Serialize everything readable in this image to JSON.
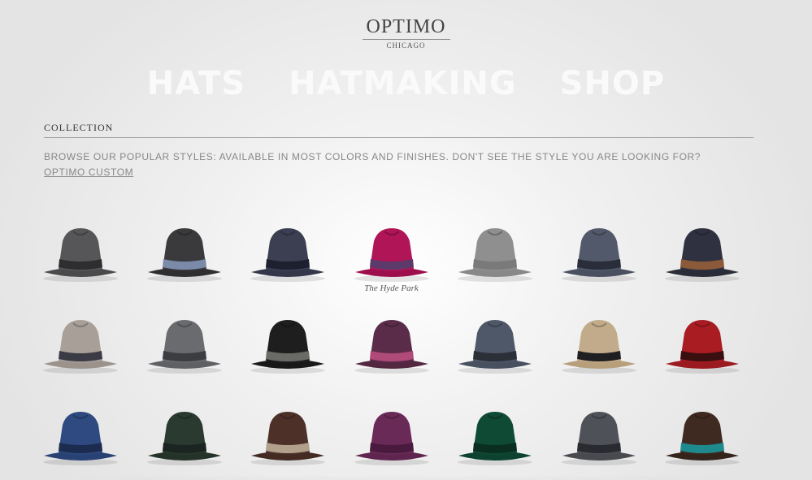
{
  "brand": {
    "name": "OPTIMO",
    "sub": "CHICAGO"
  },
  "nav": {
    "items": [
      "HATS",
      "HATMAKING",
      "SHOP"
    ]
  },
  "collection": {
    "title": "COLLECTION",
    "intro_text": "BROWSE OUR POPULAR STYLES: AVAILABLE IN MOST COLORS AND FINISHES. DON'T SEE THE STYLE YOU ARE LOOKING FOR? ",
    "intro_link": "OPTIMO CUSTOM"
  },
  "hats": [
    {
      "crown": "#565659",
      "band": "#2e2e30",
      "brim": "#4a4a4d"
    },
    {
      "crown": "#3a3a3d",
      "band": "#7a8aa8",
      "brim": "#2f2f32"
    },
    {
      "crown": "#3c3f52",
      "band": "#1e2030",
      "brim": "#34374a"
    },
    {
      "crown": "#b01558",
      "band": "#5c3a6a",
      "brim": "#9c0f4c",
      "label": "The Hyde Park"
    },
    {
      "crown": "#8f8f8f",
      "band": "#7a7a7a",
      "brim": "#888888"
    },
    {
      "crown": "#52596a",
      "band": "#2a2e3a",
      "brim": "#4a5060"
    },
    {
      "crown": "#2f3140",
      "band": "#8a5a3a",
      "brim": "#2a2c38"
    },
    {
      "crown": "#a89f98",
      "band": "#3a3b44",
      "brim": "#9a928b"
    },
    {
      "crown": "#6a6b6e",
      "band": "#3c3d40",
      "brim": "#5f6063"
    },
    {
      "crown": "#1e1e1e",
      "band": "#6a6a66",
      "brim": "#181818"
    },
    {
      "crown": "#5a2c4a",
      "band": "#b04a78",
      "brim": "#52273f"
    },
    {
      "crown": "#4f5868",
      "band": "#2a2f38",
      "brim": "#47505f"
    },
    {
      "crown": "#c2ab8a",
      "band": "#1f1f22",
      "brim": "#b89f7c"
    },
    {
      "crown": "#a81c22",
      "band": "#3a0f10",
      "brim": "#9a1a20"
    },
    {
      "crown": "#2f4a80",
      "band": "#1c2c4e",
      "brim": "#294274"
    },
    {
      "crown": "#2a3a30",
      "band": "#1a2420",
      "brim": "#243228"
    },
    {
      "crown": "#4d3128",
      "band": "#b0a08c",
      "brim": "#432a22"
    },
    {
      "crown": "#6a2a58",
      "band": "#4a1a3e",
      "brim": "#5f254f"
    },
    {
      "crown": "#0f4a34",
      "band": "#0a2e20",
      "brim": "#0d4230"
    },
    {
      "crown": "#4f5158",
      "band": "#2a2b30",
      "brim": "#484a50"
    },
    {
      "crown": "#3e2a20",
      "band": "#1f8a8e",
      "brim": "#35241b"
    }
  ]
}
